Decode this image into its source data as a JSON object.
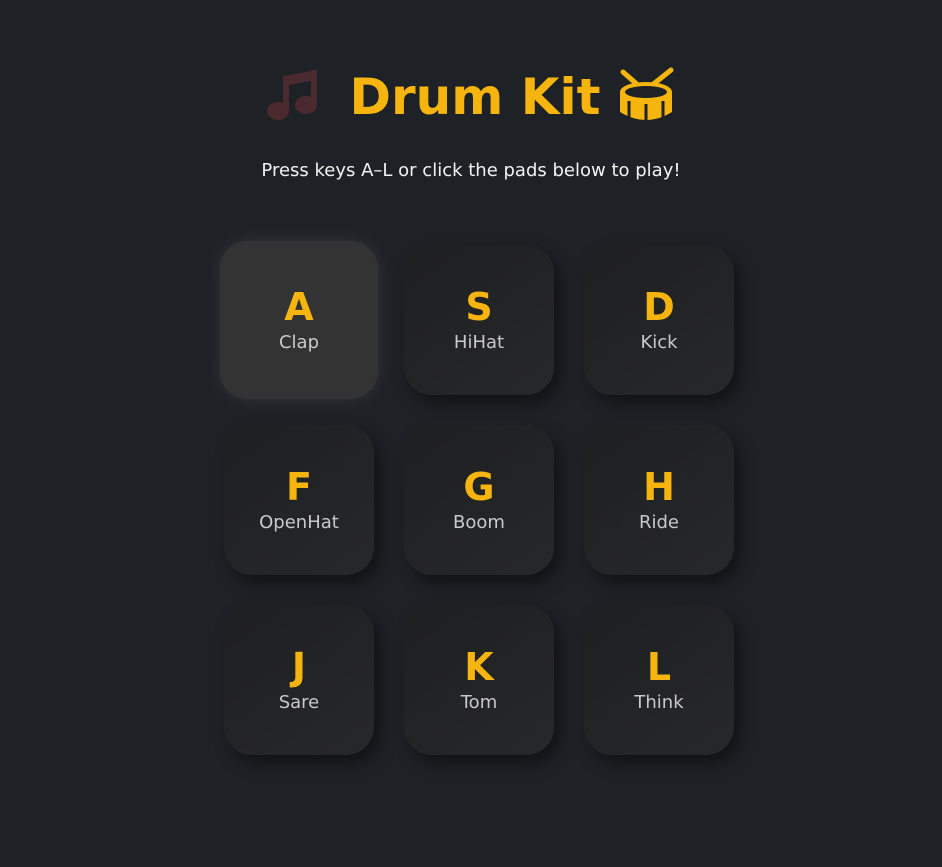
{
  "header": {
    "title": "Drum Kit",
    "left_icon": "music-note-icon",
    "right_icon": "drum-icon",
    "subtitle": "Press keys A–L or click the pads below to play!"
  },
  "colors": {
    "background": "#1e2126",
    "accent": "#f5b50e",
    "note_icon": "#4a2a2e",
    "pad": "#242526",
    "pad_active": "#333334",
    "sound_text": "#c9c9c9"
  },
  "pads": [
    {
      "key": "A",
      "sound": "Clap",
      "active": true
    },
    {
      "key": "S",
      "sound": "HiHat",
      "active": false
    },
    {
      "key": "D",
      "sound": "Kick",
      "active": false
    },
    {
      "key": "F",
      "sound": "OpenHat",
      "active": false
    },
    {
      "key": "G",
      "sound": "Boom",
      "active": false
    },
    {
      "key": "H",
      "sound": "Ride",
      "active": false
    },
    {
      "key": "J",
      "sound": "Sare",
      "active": false
    },
    {
      "key": "K",
      "sound": "Tom",
      "active": false
    },
    {
      "key": "L",
      "sound": "Think",
      "active": false
    }
  ]
}
